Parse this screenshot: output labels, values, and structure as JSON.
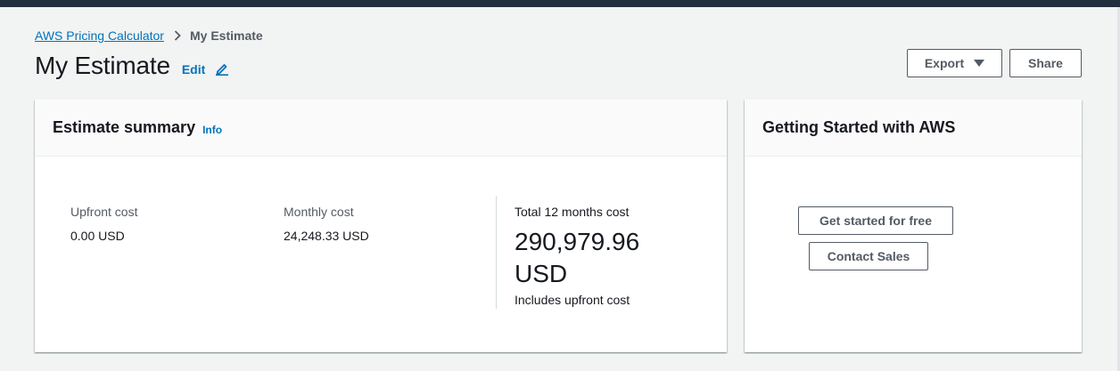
{
  "breadcrumb": {
    "root": "AWS Pricing Calculator",
    "current": "My Estimate",
    "separator_icon": "chevron-right-icon"
  },
  "header": {
    "title": "My Estimate",
    "edit_label": "Edit",
    "edit_icon": "pencil-icon"
  },
  "actions": {
    "export_label": "Export",
    "export_icon": "caret-down-icon",
    "share_label": "Share"
  },
  "summary": {
    "title": "Estimate summary",
    "info_label": "Info",
    "upfront_label": "Upfront cost",
    "upfront_value": "0.00 USD",
    "monthly_label": "Monthly cost",
    "monthly_value": "24,248.33 USD",
    "total_label": "Total 12 months cost",
    "total_value": "290,979.96 USD",
    "total_note": "Includes upfront cost"
  },
  "getting_started": {
    "title": "Getting Started with AWS",
    "get_started_label": "Get started for free",
    "contact_label": "Contact Sales"
  },
  "colors": {
    "link": "#0073bb",
    "topbar": "#232f3e",
    "page_background": "#f2f3f3",
    "button_text": "#545b64"
  }
}
